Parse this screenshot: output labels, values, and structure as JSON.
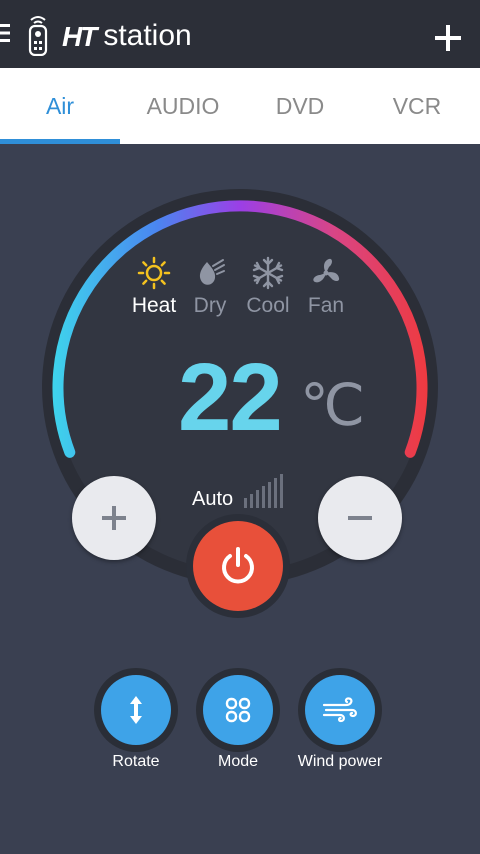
{
  "header": {
    "logo_mark": "HT",
    "logo_word": "station"
  },
  "tabs": [
    {
      "label": "Air",
      "active": true
    },
    {
      "label": "AUDIO",
      "active": false
    },
    {
      "label": "DVD",
      "active": false
    },
    {
      "label": "VCR",
      "active": false
    }
  ],
  "modes": [
    {
      "label": "Heat",
      "icon": "sun-icon",
      "active": true
    },
    {
      "label": "Dry",
      "icon": "dry-icon",
      "active": false
    },
    {
      "label": "Cool",
      "icon": "snowflake-icon",
      "active": false
    },
    {
      "label": "Fan",
      "icon": "fan-icon",
      "active": false
    }
  ],
  "temperature": {
    "value": "22",
    "unit": "℃"
  },
  "fan_speed": {
    "label": "Auto"
  },
  "functions": [
    {
      "label": "Rotate",
      "icon": "rotate-icon"
    },
    {
      "label": "Mode",
      "icon": "mode-icon"
    },
    {
      "label": "Wind power",
      "icon": "wind-icon"
    }
  ],
  "colors": {
    "accent": "#2f8fd8",
    "temperature": "#67d4ec",
    "power": "#e8503a",
    "function_button": "#3ea3e8",
    "heat_icon": "#f4c21f"
  }
}
